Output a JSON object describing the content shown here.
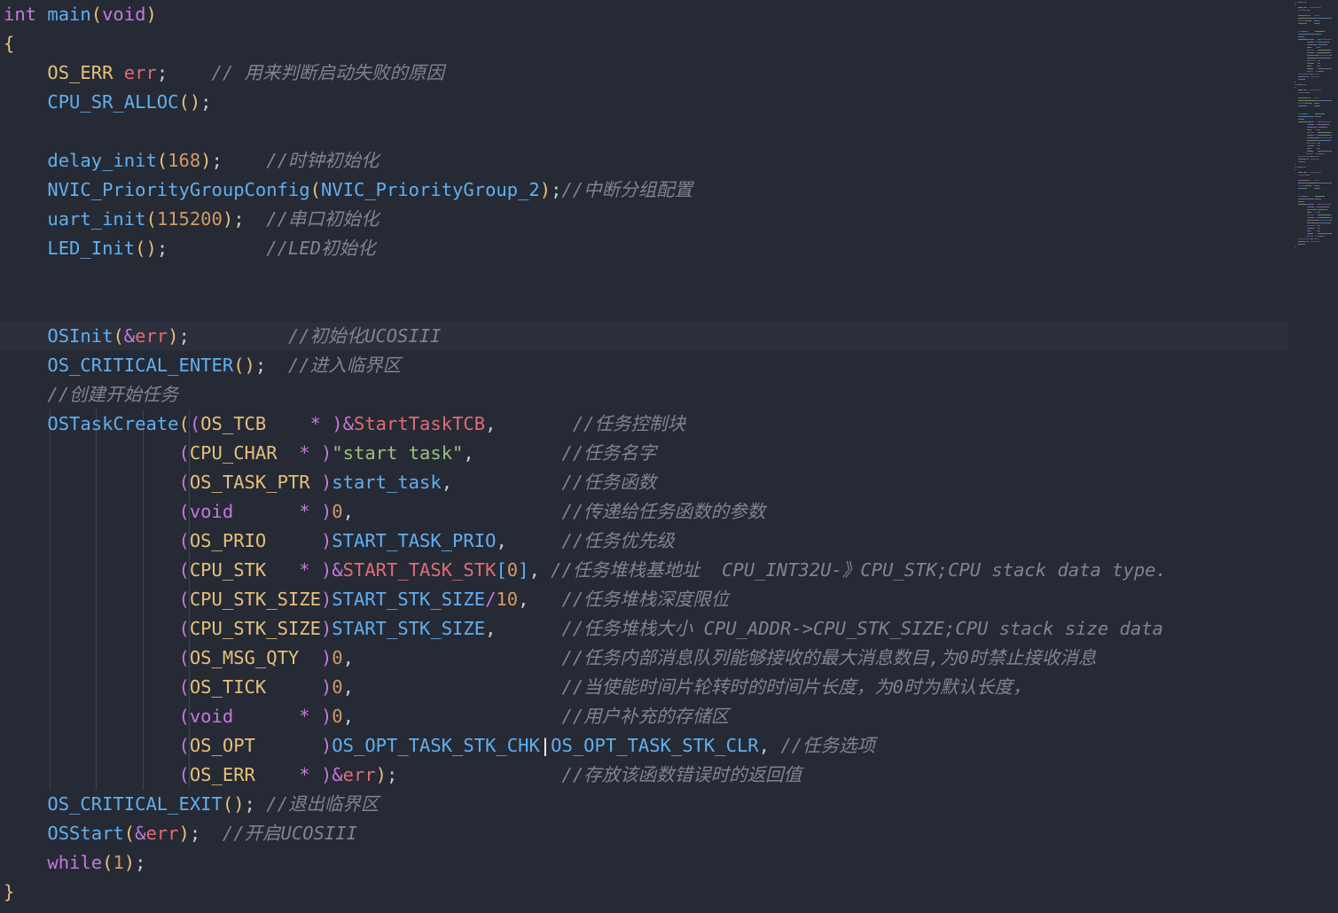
{
  "editor": {
    "lines": [
      [
        {
          "t": "int",
          "c": "kw"
        },
        {
          "t": " ",
          "c": "pl"
        },
        {
          "t": "main",
          "c": "fn"
        },
        {
          "t": "(",
          "c": "p1"
        },
        {
          "t": "void",
          "c": "kw"
        },
        {
          "t": ")",
          "c": "p1"
        }
      ],
      [
        {
          "t": "{",
          "c": "p1"
        }
      ],
      [
        {
          "t": "    ",
          "c": "pl"
        },
        {
          "t": "OS_ERR",
          "c": "type"
        },
        {
          "t": " ",
          "c": "pl"
        },
        {
          "t": "err",
          "c": "var"
        },
        {
          "t": ";",
          "c": "pl"
        },
        {
          "t": "    ",
          "c": "pl"
        },
        {
          "t": "// 用来判断启动失败的原因",
          "c": "cm"
        }
      ],
      [
        {
          "t": "    ",
          "c": "pl"
        },
        {
          "t": "CPU_SR_ALLOC",
          "c": "fn"
        },
        {
          "t": "()",
          "c": "p1"
        },
        {
          "t": ";",
          "c": "pl"
        }
      ],
      [],
      [
        {
          "t": "    ",
          "c": "pl"
        },
        {
          "t": "delay_init",
          "c": "fn"
        },
        {
          "t": "(",
          "c": "p1"
        },
        {
          "t": "168",
          "c": "num"
        },
        {
          "t": ")",
          "c": "p1"
        },
        {
          "t": ";",
          "c": "pl"
        },
        {
          "t": "    ",
          "c": "pl"
        },
        {
          "t": "//时钟初始化",
          "c": "cm"
        }
      ],
      [
        {
          "t": "    ",
          "c": "pl"
        },
        {
          "t": "NVIC_PriorityGroupConfig",
          "c": "fn"
        },
        {
          "t": "(",
          "c": "p1"
        },
        {
          "t": "NVIC_PriorityGroup_2",
          "c": "const"
        },
        {
          "t": ")",
          "c": "p1"
        },
        {
          "t": ";",
          "c": "pl"
        },
        {
          "t": "//中断分组配置",
          "c": "cm"
        }
      ],
      [
        {
          "t": "    ",
          "c": "pl"
        },
        {
          "t": "uart_init",
          "c": "fn"
        },
        {
          "t": "(",
          "c": "p1"
        },
        {
          "t": "115200",
          "c": "num"
        },
        {
          "t": ")",
          "c": "p1"
        },
        {
          "t": ";",
          "c": "pl"
        },
        {
          "t": "  ",
          "c": "pl"
        },
        {
          "t": "//串口初始化",
          "c": "cm"
        }
      ],
      [
        {
          "t": "    ",
          "c": "pl"
        },
        {
          "t": "LED_Init",
          "c": "fn"
        },
        {
          "t": "()",
          "c": "p1"
        },
        {
          "t": ";",
          "c": "pl"
        },
        {
          "t": "         ",
          "c": "pl"
        },
        {
          "t": "//LED初始化",
          "c": "cm"
        }
      ],
      [],
      [],
      [
        {
          "t": "    ",
          "c": "pl"
        },
        {
          "t": "OSInit",
          "c": "fn"
        },
        {
          "t": "(",
          "c": "p1"
        },
        {
          "t": "&",
          "c": "op"
        },
        {
          "t": "err",
          "c": "var"
        },
        {
          "t": ")",
          "c": "p1"
        },
        {
          "t": ";",
          "c": "pl"
        },
        {
          "t": "         ",
          "c": "pl"
        },
        {
          "t": "//初始化UCOSIII",
          "c": "cm"
        }
      ],
      [
        {
          "t": "    ",
          "c": "pl"
        },
        {
          "t": "OS_CRITICAL_ENTER",
          "c": "fn"
        },
        {
          "t": "()",
          "c": "p1"
        },
        {
          "t": ";",
          "c": "pl"
        },
        {
          "t": "  ",
          "c": "pl"
        },
        {
          "t": "//进入临界区",
          "c": "cm"
        }
      ],
      [
        {
          "t": "    ",
          "c": "pl"
        },
        {
          "t": "//创建开始任务",
          "c": "cm"
        }
      ],
      [
        {
          "t": "    ",
          "c": "pl"
        },
        {
          "t": "OSTaskCreate",
          "c": "fn"
        },
        {
          "t": "(",
          "c": "p1"
        },
        {
          "t": "(",
          "c": "p2"
        },
        {
          "t": "OS_TCB",
          "c": "type"
        },
        {
          "t": "    ",
          "c": "pl"
        },
        {
          "t": "*",
          "c": "op"
        },
        {
          "t": " ",
          "c": "pl"
        },
        {
          "t": ")",
          "c": "p2"
        },
        {
          "t": "&",
          "c": "op"
        },
        {
          "t": "StartTaskTCB",
          "c": "var"
        },
        {
          "t": ",",
          "c": "pl"
        },
        {
          "t": "       ",
          "c": "pl"
        },
        {
          "t": "//任务控制块",
          "c": "cm"
        }
      ],
      [
        {
          "t": "                ",
          "c": "pl"
        },
        {
          "t": "(",
          "c": "p2"
        },
        {
          "t": "CPU_CHAR",
          "c": "type"
        },
        {
          "t": "  ",
          "c": "pl"
        },
        {
          "t": "*",
          "c": "op"
        },
        {
          "t": " ",
          "c": "pl"
        },
        {
          "t": ")",
          "c": "p2"
        },
        {
          "t": "\"start task\"",
          "c": "str"
        },
        {
          "t": ",",
          "c": "pl"
        },
        {
          "t": "        ",
          "c": "pl"
        },
        {
          "t": "//任务名字",
          "c": "cm"
        }
      ],
      [
        {
          "t": "                ",
          "c": "pl"
        },
        {
          "t": "(",
          "c": "p2"
        },
        {
          "t": "OS_TASK_PTR",
          "c": "type"
        },
        {
          "t": " ",
          "c": "pl"
        },
        {
          "t": ")",
          "c": "p2"
        },
        {
          "t": "start_task",
          "c": "fn"
        },
        {
          "t": ",",
          "c": "pl"
        },
        {
          "t": "          ",
          "c": "pl"
        },
        {
          "t": "//任务函数",
          "c": "cm"
        }
      ],
      [
        {
          "t": "                ",
          "c": "pl"
        },
        {
          "t": "(",
          "c": "p2"
        },
        {
          "t": "void",
          "c": "kw"
        },
        {
          "t": "      ",
          "c": "pl"
        },
        {
          "t": "*",
          "c": "op"
        },
        {
          "t": " ",
          "c": "pl"
        },
        {
          "t": ")",
          "c": "p2"
        },
        {
          "t": "0",
          "c": "num"
        },
        {
          "t": ",",
          "c": "pl"
        },
        {
          "t": "                   ",
          "c": "pl"
        },
        {
          "t": "//传递给任务函数的参数",
          "c": "cm"
        }
      ],
      [
        {
          "t": "                ",
          "c": "pl"
        },
        {
          "t": "(",
          "c": "p2"
        },
        {
          "t": "OS_PRIO",
          "c": "type"
        },
        {
          "t": "     ",
          "c": "pl"
        },
        {
          "t": ")",
          "c": "p2"
        },
        {
          "t": "START_TASK_PRIO",
          "c": "const"
        },
        {
          "t": ",",
          "c": "pl"
        },
        {
          "t": "     ",
          "c": "pl"
        },
        {
          "t": "//任务优先级",
          "c": "cm"
        }
      ],
      [
        {
          "t": "                ",
          "c": "pl"
        },
        {
          "t": "(",
          "c": "p2"
        },
        {
          "t": "CPU_STK",
          "c": "type"
        },
        {
          "t": "   ",
          "c": "pl"
        },
        {
          "t": "*",
          "c": "op"
        },
        {
          "t": " ",
          "c": "pl"
        },
        {
          "t": ")",
          "c": "p2"
        },
        {
          "t": "&",
          "c": "op"
        },
        {
          "t": "START_TASK_STK",
          "c": "var"
        },
        {
          "t": "[",
          "c": "p3"
        },
        {
          "t": "0",
          "c": "num"
        },
        {
          "t": "]",
          "c": "p3"
        },
        {
          "t": ",",
          "c": "pl"
        },
        {
          "t": " ",
          "c": "pl"
        },
        {
          "t": "//任务堆栈基地址  CPU_INT32U-》CPU_STK;CPU stack data type.",
          "c": "cm"
        }
      ],
      [
        {
          "t": "                ",
          "c": "pl"
        },
        {
          "t": "(",
          "c": "p2"
        },
        {
          "t": "CPU_STK_SIZE",
          "c": "type"
        },
        {
          "t": ")",
          "c": "p2"
        },
        {
          "t": "START_STK_SIZE",
          "c": "const"
        },
        {
          "t": "/",
          "c": "op"
        },
        {
          "t": "10",
          "c": "num"
        },
        {
          "t": ",",
          "c": "pl"
        },
        {
          "t": "   ",
          "c": "pl"
        },
        {
          "t": "//任务堆栈深度限位",
          "c": "cm"
        }
      ],
      [
        {
          "t": "                ",
          "c": "pl"
        },
        {
          "t": "(",
          "c": "p2"
        },
        {
          "t": "CPU_STK_SIZE",
          "c": "type"
        },
        {
          "t": ")",
          "c": "p2"
        },
        {
          "t": "START_STK_SIZE",
          "c": "const"
        },
        {
          "t": ",",
          "c": "pl"
        },
        {
          "t": "      ",
          "c": "pl"
        },
        {
          "t": "//任务堆栈大小 CPU_ADDR->CPU_STK_SIZE;CPU stack size data",
          "c": "cm"
        }
      ],
      [
        {
          "t": "                ",
          "c": "pl"
        },
        {
          "t": "(",
          "c": "p2"
        },
        {
          "t": "OS_MSG_QTY",
          "c": "type"
        },
        {
          "t": "  ",
          "c": "pl"
        },
        {
          "t": ")",
          "c": "p2"
        },
        {
          "t": "0",
          "c": "num"
        },
        {
          "t": ",",
          "c": "pl"
        },
        {
          "t": "                   ",
          "c": "pl"
        },
        {
          "t": "//任务内部消息队列能够接收的最大消息数目,为0时禁止接收消息",
          "c": "cm"
        }
      ],
      [
        {
          "t": "                ",
          "c": "pl"
        },
        {
          "t": "(",
          "c": "p2"
        },
        {
          "t": "OS_TICK",
          "c": "type"
        },
        {
          "t": "     ",
          "c": "pl"
        },
        {
          "t": ")",
          "c": "p2"
        },
        {
          "t": "0",
          "c": "num"
        },
        {
          "t": ",",
          "c": "pl"
        },
        {
          "t": "                   ",
          "c": "pl"
        },
        {
          "t": "//当使能时间片轮转时的时间片长度，为0时为默认长度，",
          "c": "cm"
        }
      ],
      [
        {
          "t": "                ",
          "c": "pl"
        },
        {
          "t": "(",
          "c": "p2"
        },
        {
          "t": "void",
          "c": "kw"
        },
        {
          "t": "      ",
          "c": "pl"
        },
        {
          "t": "*",
          "c": "op"
        },
        {
          "t": " ",
          "c": "pl"
        },
        {
          "t": ")",
          "c": "p2"
        },
        {
          "t": "0",
          "c": "num"
        },
        {
          "t": ",",
          "c": "pl"
        },
        {
          "t": "                   ",
          "c": "pl"
        },
        {
          "t": "//用户补充的存储区",
          "c": "cm"
        }
      ],
      [
        {
          "t": "                ",
          "c": "pl"
        },
        {
          "t": "(",
          "c": "p2"
        },
        {
          "t": "OS_OPT",
          "c": "type"
        },
        {
          "t": "      ",
          "c": "pl"
        },
        {
          "t": ")",
          "c": "p2"
        },
        {
          "t": "OS_OPT_TASK_STK_CHK",
          "c": "const"
        },
        {
          "t": "|",
          "c": "cur"
        },
        {
          "t": "OS_OPT_TASK_STK_CLR",
          "c": "const"
        },
        {
          "t": ",",
          "c": "pl"
        },
        {
          "t": " ",
          "c": "pl"
        },
        {
          "t": "//任务选项",
          "c": "cm"
        }
      ],
      [
        {
          "t": "                ",
          "c": "pl"
        },
        {
          "t": "(",
          "c": "p2"
        },
        {
          "t": "OS_ERR",
          "c": "type"
        },
        {
          "t": "    ",
          "c": "pl"
        },
        {
          "t": "*",
          "c": "op"
        },
        {
          "t": " ",
          "c": "pl"
        },
        {
          "t": ")",
          "c": "p2"
        },
        {
          "t": "&",
          "c": "op"
        },
        {
          "t": "err",
          "c": "var"
        },
        {
          "t": ")",
          "c": "p1"
        },
        {
          "t": ";",
          "c": "pl"
        },
        {
          "t": "               ",
          "c": "pl"
        },
        {
          "t": "//存放该函数错误时的返回值",
          "c": "cm"
        }
      ],
      [
        {
          "t": "    ",
          "c": "pl"
        },
        {
          "t": "OS_CRITICAL_EXIT",
          "c": "fn"
        },
        {
          "t": "()",
          "c": "p1"
        },
        {
          "t": ";",
          "c": "pl"
        },
        {
          "t": " ",
          "c": "pl"
        },
        {
          "t": "//退出临界区",
          "c": "cm"
        }
      ],
      [
        {
          "t": "    ",
          "c": "pl"
        },
        {
          "t": "OSStart",
          "c": "fn"
        },
        {
          "t": "(",
          "c": "p1"
        },
        {
          "t": "&",
          "c": "op"
        },
        {
          "t": "err",
          "c": "var"
        },
        {
          "t": ")",
          "c": "p1"
        },
        {
          "t": ";",
          "c": "pl"
        },
        {
          "t": "  ",
          "c": "pl"
        },
        {
          "t": "//开启UCOSIII",
          "c": "cm"
        }
      ],
      [
        {
          "t": "    ",
          "c": "pl"
        },
        {
          "t": "while",
          "c": "kw"
        },
        {
          "t": "(",
          "c": "p1"
        },
        {
          "t": "1",
          "c": "num"
        },
        {
          "t": ")",
          "c": "p1"
        },
        {
          "t": ";",
          "c": "pl"
        }
      ],
      [
        {
          "t": "}",
          "c": "p1"
        }
      ]
    ],
    "current_line_index": 11,
    "guide_lines": [
      14,
      15,
      16,
      17,
      18,
      19,
      20,
      21,
      22,
      23,
      24,
      25,
      26
    ]
  },
  "colors": {
    "background": "#262a35",
    "keyword": "#c678dd",
    "type": "#e5c07b",
    "variable": "#e06c75",
    "function": "#61afef",
    "number": "#d19a66",
    "string": "#98c379",
    "comment": "#7f848e"
  }
}
